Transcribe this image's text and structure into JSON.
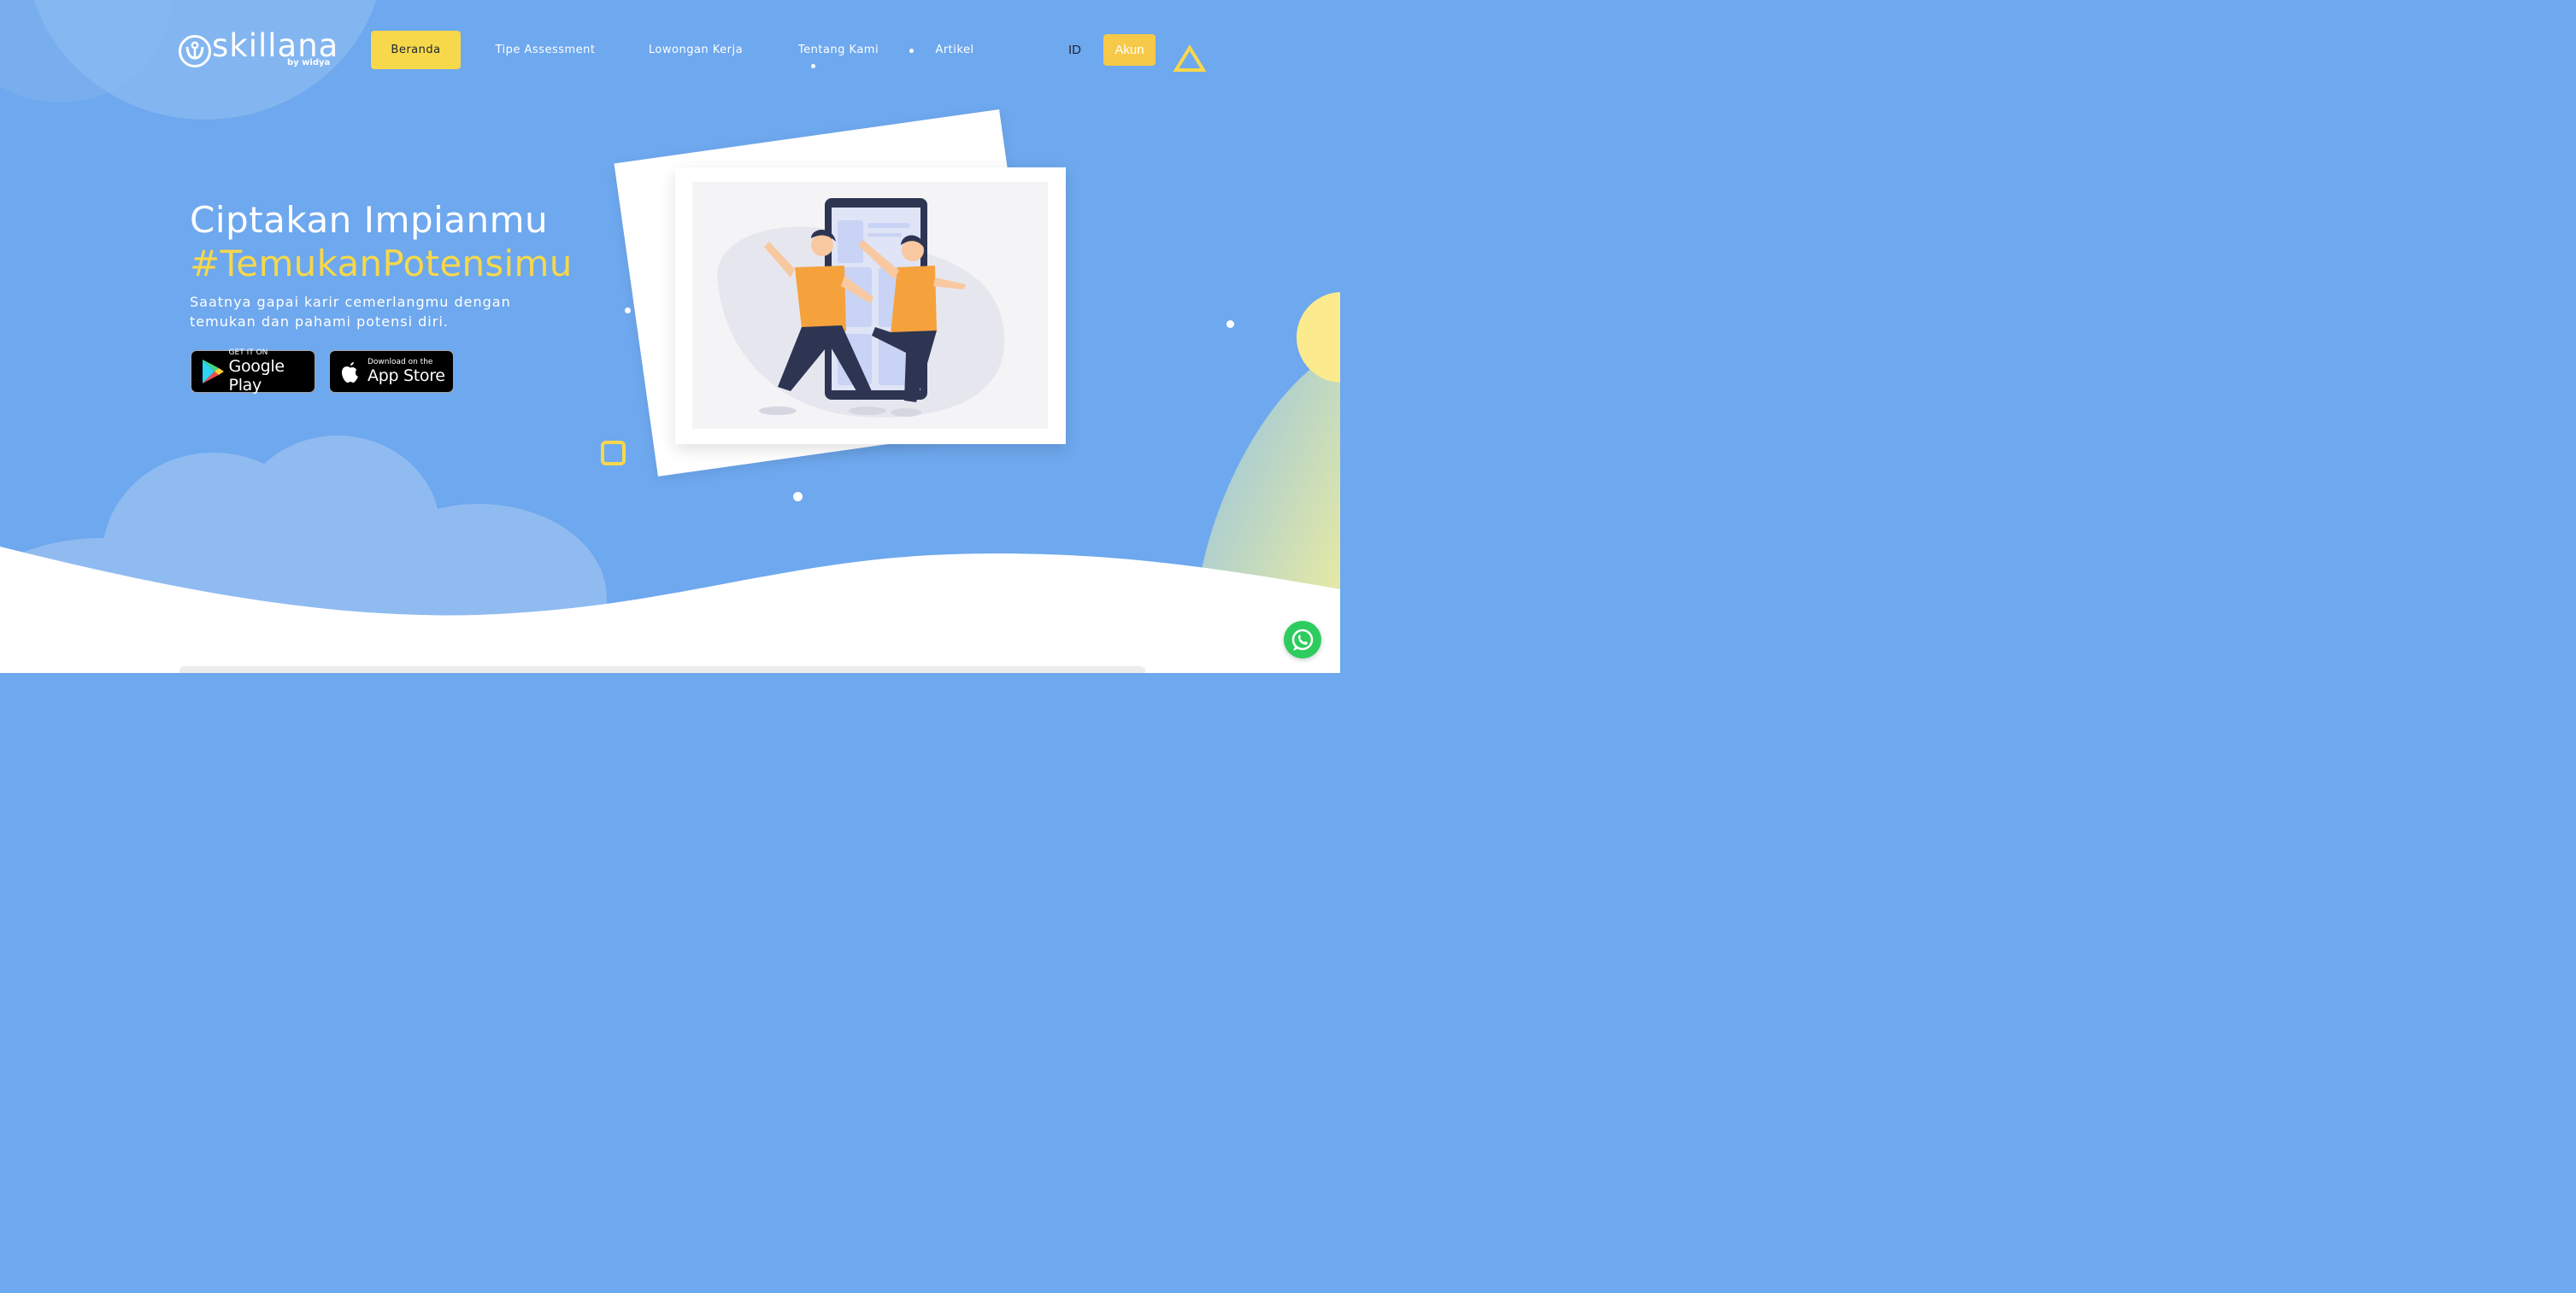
{
  "brand": {
    "name": "skillana",
    "tagline": "by widya"
  },
  "nav": {
    "items": [
      "Beranda",
      "Tipe Assessment",
      "Lowongan Kerja",
      "Tentang Kami",
      "Artikel"
    ],
    "active": "Beranda",
    "language": "ID",
    "account_label": "Akun"
  },
  "hero": {
    "title": "Ciptakan Impianmu",
    "hashtag": "#TemukanPotensimu",
    "subtitle": "Saatnya gapai karir cemerlangmu dengan temukan dan pahami potensi diri."
  },
  "stores": {
    "google": {
      "small": "GET IT ON",
      "big": "Google Play"
    },
    "apple": {
      "small": "Download on the",
      "big": "App Store"
    }
  },
  "colors": {
    "background": "#6ea8ee",
    "accent_yellow": "#f7d84a",
    "account_button": "#f7c948",
    "whatsapp": "#2ecc5e"
  },
  "icons": [
    "logo-icon",
    "google-play-icon",
    "apple-icon",
    "triangle-icon",
    "whatsapp-icon"
  ]
}
